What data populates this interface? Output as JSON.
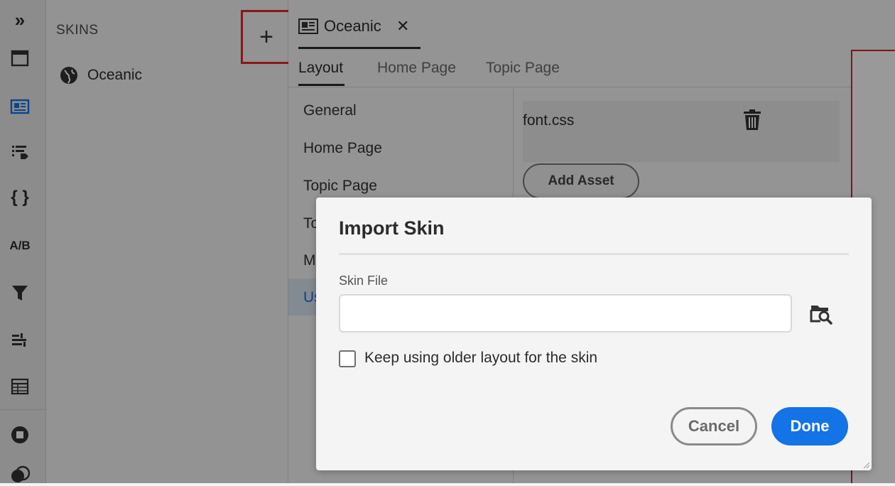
{
  "colors": {
    "accent": "#1473e6",
    "highlight": "#e8262a",
    "overlay": "rgba(0,0,0,0.4)"
  },
  "rail": {
    "icons": [
      "chevron-double-right-icon",
      "window-icon",
      "layout-icon",
      "list-tag-icon",
      "braces-icon",
      "ab-test-icon",
      "filter-icon",
      "sliders-icon",
      "table-icon",
      "stop-icon",
      "overlap-icon"
    ],
    "ab_label": "A/B",
    "braces_label": "{ }",
    "expand_label": "»"
  },
  "skins": {
    "title": "SKINS",
    "add_label": "+",
    "items": [
      {
        "label": "Oceanic",
        "icon": "globe-icon"
      }
    ]
  },
  "editor": {
    "tab_label": "Oceanic",
    "tab_close": "✕",
    "subtabs": [
      "Layout",
      "Home Page",
      "Topic Page"
    ],
    "side_items": [
      "General",
      "Home Page",
      "Topic Page",
      "To",
      "M",
      "Us"
    ],
    "asset_name": "font.css",
    "add_asset_label": "Add Asset"
  },
  "dialog": {
    "title": "Import Skin",
    "file_label": "Skin File",
    "file_value": "",
    "keep_label": "Keep using older layout for the skin",
    "keep_checked": false,
    "cancel_label": "Cancel",
    "done_label": "Done"
  }
}
